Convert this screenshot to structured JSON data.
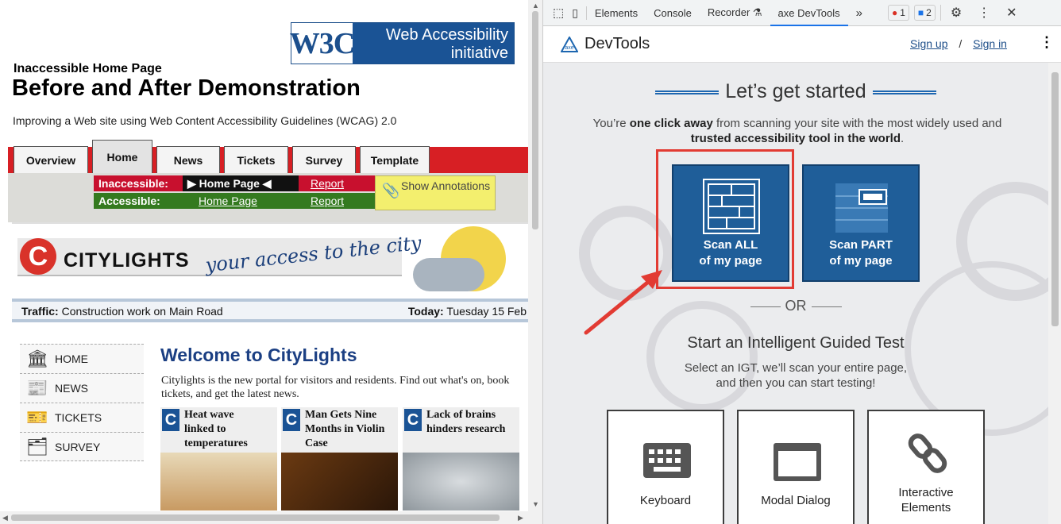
{
  "left_page": {
    "w3c_logo": {
      "mark": "W3C",
      "line1": "Web Accessibility",
      "line2": "initiative"
    },
    "pretitle": "Inaccessible Home Page",
    "title": "Before and After Demonstration",
    "subtitle": "Improving a Web site using Web Content Accessibility Guidelines (WCAG) 2.0",
    "tabs": [
      "Overview",
      "Home",
      "News",
      "Tickets",
      "Survey",
      "Template"
    ],
    "active_tab": "Home",
    "demo": {
      "inaccessible_label": "Inaccessible:",
      "inaccessible_page": "▶ Home Page ◀",
      "inaccessible_report": "Report",
      "accessible_label": "Accessible:",
      "accessible_page": "Home Page",
      "accessible_report": "Report",
      "annotations": "Show Annotations"
    },
    "citylights": {
      "logo_letter": "C",
      "name": "CITYLIGHTS",
      "tagline": "your access to the city"
    },
    "traffic_label": "Traffic:",
    "traffic_text": "Construction work on Main Road",
    "today_label": "Today:",
    "today_text": "Tuesday 15 Feb",
    "side_nav": [
      {
        "label": "HOME",
        "icon": "building-icon"
      },
      {
        "label": "NEWS",
        "icon": "newspaper-icon"
      },
      {
        "label": "TICKETS",
        "icon": "ticket-icon"
      },
      {
        "label": "SURVEY",
        "icon": "survey-icon"
      }
    ],
    "welcome_title": "Welcome to CityLights",
    "welcome_text": "Citylights is the new portal for visitors and residents. Find out what's on, book tickets, and get the latest news.",
    "news": [
      {
        "headline": "Heat wave linked to temperatures"
      },
      {
        "headline": "Man Gets Nine Months in Violin Case"
      },
      {
        "headline": "Lack of brains hinders research"
      }
    ]
  },
  "devtools": {
    "toolbar": {
      "tabs": [
        "Elements",
        "Console",
        "Recorder ⚗",
        "axe DevTools"
      ],
      "active_tab": "axe DevTools",
      "more": "»",
      "errors_count": "1",
      "messages_count": "2"
    },
    "brand": "DevTools",
    "sign_up": "Sign up",
    "separator": "/",
    "sign_in": "Sign in",
    "heading": "Let’s get started",
    "lead_1": "You’re ",
    "lead_bold_1": "one click away",
    "lead_2": " from scanning your site with the most widely used and ",
    "lead_bold_2": "trusted accessibility tool in the world",
    "lead_3": ".",
    "scan_all": {
      "line1": "Scan ALL",
      "line2": "of my page"
    },
    "scan_part": {
      "line1": "Scan PART",
      "line2": "of my page"
    },
    "or": "OR",
    "igt_title": "Start an Intelligent Guided Test",
    "igt_desc_1": "Select an IGT, we’ll scan your entire page,",
    "igt_desc_2": "and then you can start testing!",
    "cards": [
      {
        "label": "Keyboard",
        "icon": "keyboard-icon"
      },
      {
        "label": "Modal Dialog",
        "icon": "modal-window-icon"
      },
      {
        "label": "Interactive Elements",
        "icon": "chain-link-icon"
      }
    ],
    "colors": {
      "accent": "#1f5e99",
      "highlight": "#e23b33",
      "w3c_blue": "#1a5395",
      "tab_red": "#d71f24"
    }
  }
}
